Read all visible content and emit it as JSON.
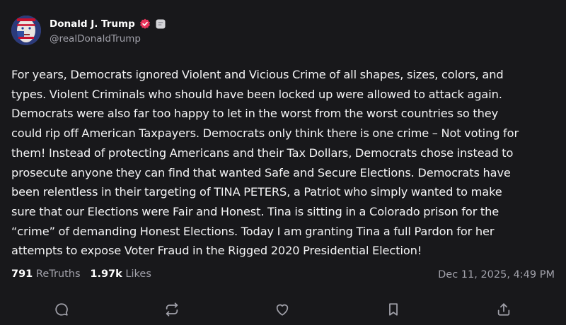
{
  "author": {
    "display_name": "Donald J. Trump",
    "handle": "@realDonaldTrump",
    "verified": true,
    "verified_color": "#e8345a",
    "avatar_icon": "avatar-flag-portrait"
  },
  "post": {
    "text_lines": [
      "For years, Democrats ignored Violent and Vicious Crime of all shapes, sizes, colors, and",
      "types. Violent Criminals who should have been locked up were allowed to attack again.",
      "Democrats were also far too happy to let in the worst from the worst countries so they",
      "could rip off American Taxpayers. Democrats only think there is one crime – Not voting for",
      "them! Instead of protecting Americans and their Tax Dollars, Democrats chose instead to",
      "prosecute anyone they can find that wanted Safe and Secure Elections. Democrats have",
      "been relentless in their targeting of TINA PETERS, a Patriot who simply wanted to make",
      "sure that our Elections were Fair and Honest. Tina is sitting in a Colorado prison for the",
      "“crime” of demanding Honest Elections. Today I am granting Tina a full Pardon for her",
      "attempts to expose Voter Fraud in the Rigged 2020 Presidential Election!"
    ]
  },
  "stats": {
    "retruths_count": "791",
    "retruths_label": "ReTruths",
    "likes_count": "1.97k",
    "likes_label": "Likes",
    "timestamp": "Dec 11, 2025, 4:49 PM"
  },
  "actions": [
    {
      "name": "reply-button",
      "icon": "comment-icon"
    },
    {
      "name": "retruth-button",
      "icon": "repost-icon"
    },
    {
      "name": "like-button",
      "icon": "heart-icon"
    },
    {
      "name": "bookmark-button",
      "icon": "bookmark-icon"
    },
    {
      "name": "share-button",
      "icon": "share-icon"
    }
  ],
  "colors": {
    "background": "#18181b",
    "text": "#f4f4f5",
    "muted": "#a1a1aa",
    "icon": "#a1a1aa"
  }
}
